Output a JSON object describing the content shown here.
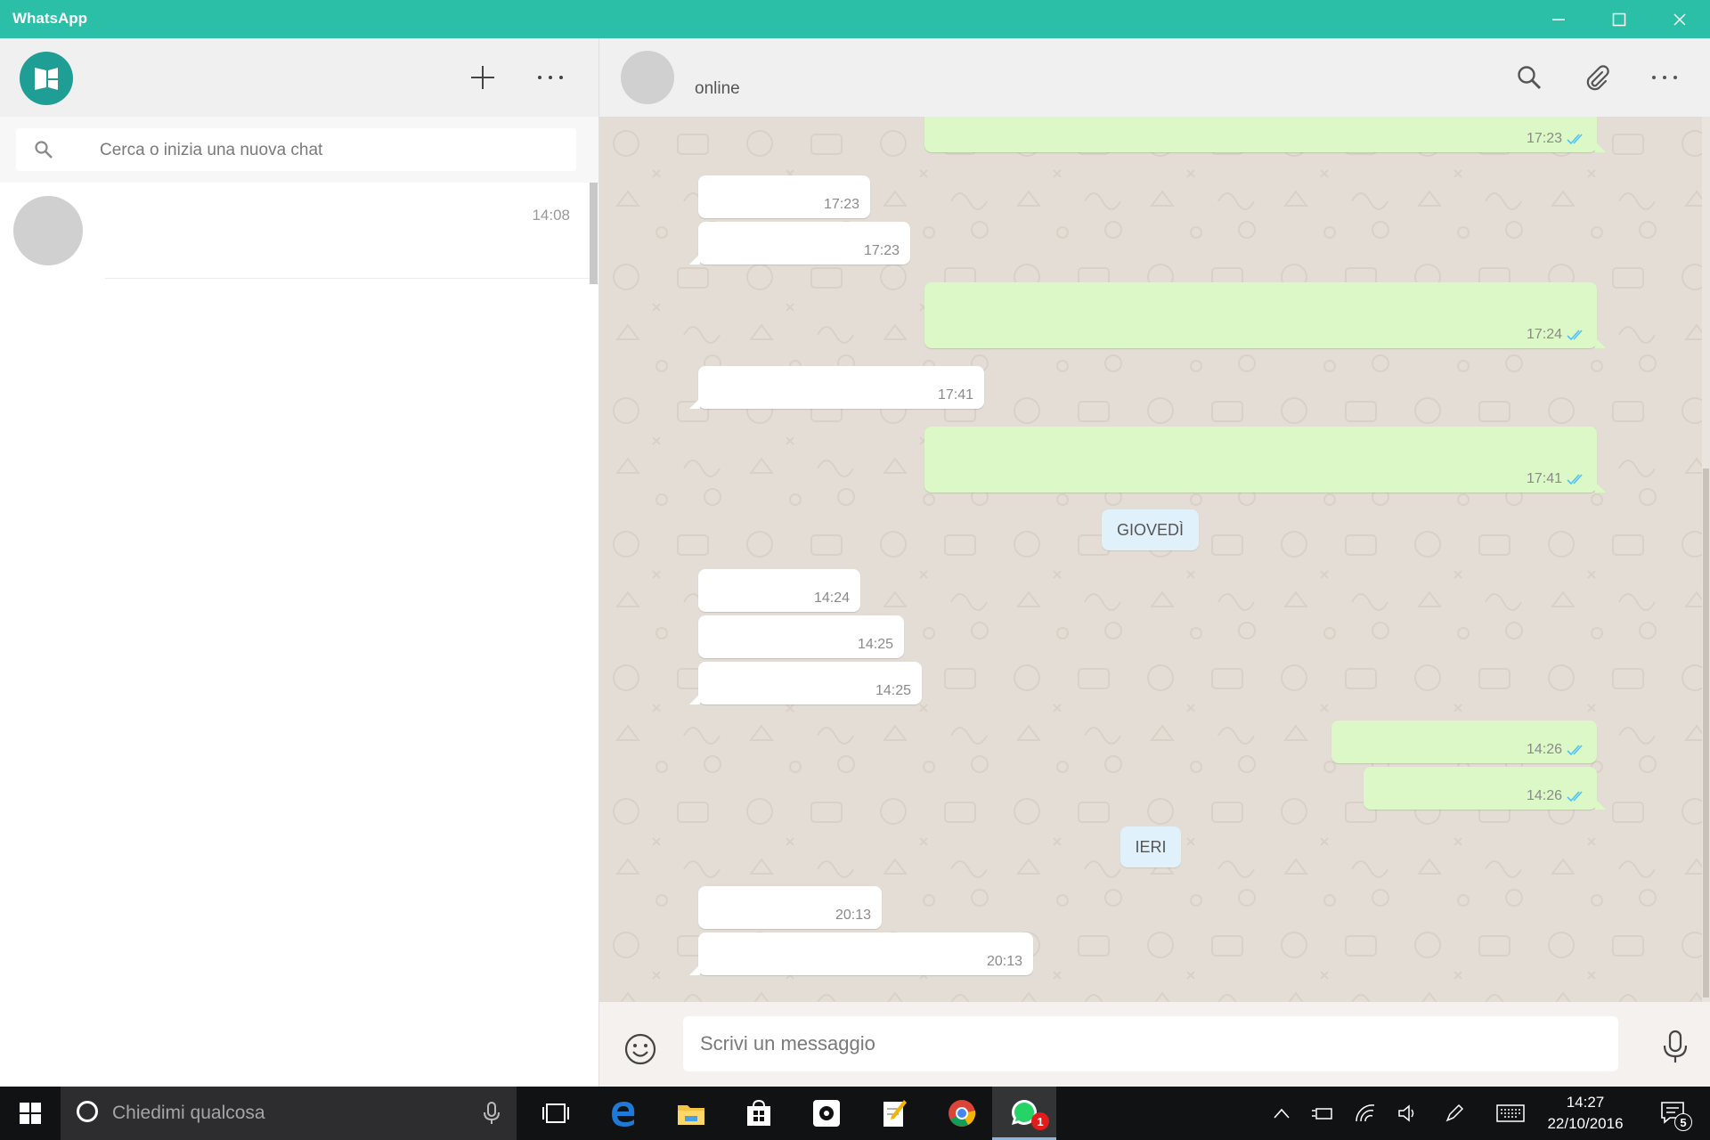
{
  "window": {
    "title": "WhatsApp",
    "accent": "#2bbfa7"
  },
  "sidebar": {
    "search_placeholder": "Cerca o inizia una nuova chat",
    "chats": [
      {
        "time": "14:08"
      }
    ]
  },
  "conversation": {
    "status": "online",
    "messages": [
      {
        "dir": "out",
        "time": "17:23",
        "read": true
      },
      {
        "dir": "in",
        "time": "17:23"
      },
      {
        "dir": "in",
        "time": "17:23"
      },
      {
        "dir": "out",
        "time": "17:24",
        "read": true
      },
      {
        "dir": "in",
        "time": "17:41"
      },
      {
        "dir": "out",
        "time": "17:41",
        "read": true
      },
      {
        "dir": "in",
        "time": "14:24"
      },
      {
        "dir": "in",
        "time": "14:25"
      },
      {
        "dir": "in",
        "time": "14:25"
      },
      {
        "dir": "out",
        "time": "14:26",
        "read": true
      },
      {
        "dir": "out",
        "time": "14:26",
        "read": true
      },
      {
        "dir": "in",
        "time": "20:13"
      },
      {
        "dir": "in",
        "time": "20:13"
      }
    ],
    "date_separators": [
      "GIOVEDÌ",
      "IERI"
    ],
    "composer_placeholder": "Scrivi un messaggio",
    "bubble_out_color": "#dcf8c6",
    "read_tick_color": "#4fc3f7"
  },
  "taskbar": {
    "search_placeholder": "Chiedimi qualcosa",
    "whatsapp_badge": "1",
    "notifications_count": "5",
    "time": "14:27",
    "date": "22/10/2016"
  }
}
